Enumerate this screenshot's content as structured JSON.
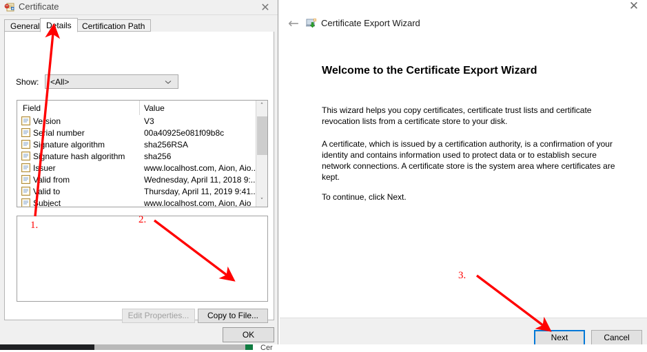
{
  "certificate_dialog": {
    "title": "Certificate",
    "title_icon": "certificate-icon",
    "close_label": "✕",
    "tabs": [
      {
        "label": "General",
        "active": false
      },
      {
        "label": "Details",
        "active": true
      },
      {
        "label": "Certification Path",
        "active": false
      }
    ],
    "show": {
      "label": "Show:",
      "selected": "<All>",
      "chevron": "chevron-down-icon"
    },
    "field_table": {
      "headers": [
        "Field",
        "Value"
      ],
      "rows": [
        {
          "field": "Version",
          "value": "V3"
        },
        {
          "field": "Serial number",
          "value": "00a40925e081f09b8c"
        },
        {
          "field": "Signature algorithm",
          "value": "sha256RSA"
        },
        {
          "field": "Signature hash algorithm",
          "value": "sha256"
        },
        {
          "field": "Issuer",
          "value": "www.localhost.com, Aion, Aio..."
        },
        {
          "field": "Valid from",
          "value": "Wednesday, April 11, 2018 9:..."
        },
        {
          "field": "Valid to",
          "value": "Thursday, April 11, 2019 9:41..."
        },
        {
          "field": "Subject",
          "value": "www.localhost.com, Aion, Aio"
        }
      ],
      "scroll_up": "˄",
      "scroll_down": "˅"
    },
    "detail_value": "",
    "buttons": {
      "edit_properties": "Edit Properties...",
      "copy_to_file": "Copy to File...",
      "ok": "OK"
    }
  },
  "wizard": {
    "close_label": "✕",
    "back_label": "←",
    "head_icon": "certificate-export-icon",
    "head_title": "Certificate Export Wizard",
    "heading": "Welcome to the Certificate Export Wizard",
    "paragraph_1": "This wizard helps you copy certificates, certificate trust lists and certificate revocation lists from a certificate store to your disk.",
    "paragraph_2": "A certificate, which is issued by a certification authority, is a confirmation of your identity and contains information used to protect data or to establish secure network connections. A certificate store is the system area where certificates are kept.",
    "paragraph_3": "To continue, click Next.",
    "buttons": {
      "next": "Next",
      "cancel": "Cancel"
    }
  },
  "annotations": {
    "step_1": "1.",
    "step_2": "2.",
    "step_3": "3.",
    "color": "#ff0000"
  },
  "taskbar": {
    "label": "Cer"
  }
}
